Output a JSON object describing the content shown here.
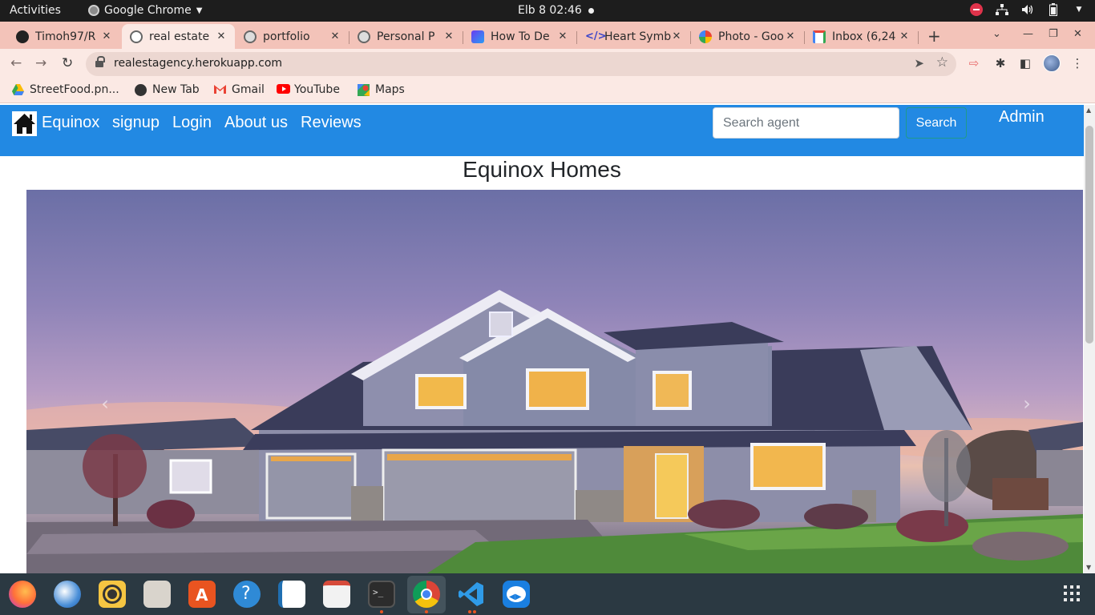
{
  "system_bar": {
    "activities": "Activities",
    "app_name": "Google Chrome",
    "clock": "Elb 8  02:46"
  },
  "tabs": [
    {
      "title": "Timoh97/R",
      "favicon": "github-icon",
      "active": false
    },
    {
      "title": "real estate",
      "favicon": "globe-icon",
      "active": true
    },
    {
      "title": "portfolio",
      "favicon": "globe-icon",
      "active": false
    },
    {
      "title": "Personal P",
      "favicon": "globe-icon",
      "active": false
    },
    {
      "title": "How To De",
      "favicon": "howto-icon",
      "active": false
    },
    {
      "title": "Heart Symb",
      "favicon": "code-icon",
      "active": false
    },
    {
      "title": "Photo - Goo",
      "favicon": "photos-icon",
      "active": false
    },
    {
      "title": "Inbox (6,24",
      "favicon": "gmail-icon",
      "active": false
    }
  ],
  "address_bar": {
    "url": "realestagency.herokuapp.com"
  },
  "bookmarks": [
    {
      "label": "StreetFood.pn...",
      "icon": "drive-icon"
    },
    {
      "label": "New Tab",
      "icon": "globe-icon"
    },
    {
      "label": "Gmail",
      "icon": "gmail-icon"
    },
    {
      "label": "YouTube",
      "icon": "youtube-icon"
    },
    {
      "label": "Maps",
      "icon": "maps-icon"
    }
  ],
  "site": {
    "brand": "Equinox",
    "nav": {
      "signup": "signup",
      "login": "Login",
      "about": "About us",
      "reviews": "Reviews"
    },
    "search": {
      "placeholder": "Search agent",
      "button": "Search"
    },
    "admin": "Admin",
    "title": "Equinox Homes",
    "hero_image": "two-story house at dusk"
  },
  "colors": {
    "navbar": "#2289e3",
    "tabstrip": "#f3c3b9",
    "toolbar": "#fbe9e4",
    "dock": "#2b3942"
  },
  "dock_apps": [
    "firefox-icon",
    "thunderbird-icon",
    "rhythmbox-icon",
    "files-icon",
    "software-center-icon",
    "help-icon",
    "writer-icon",
    "document-viewer-icon",
    "terminal-icon",
    "chrome-icon",
    "vscode-icon",
    "teamviewer-icon"
  ]
}
